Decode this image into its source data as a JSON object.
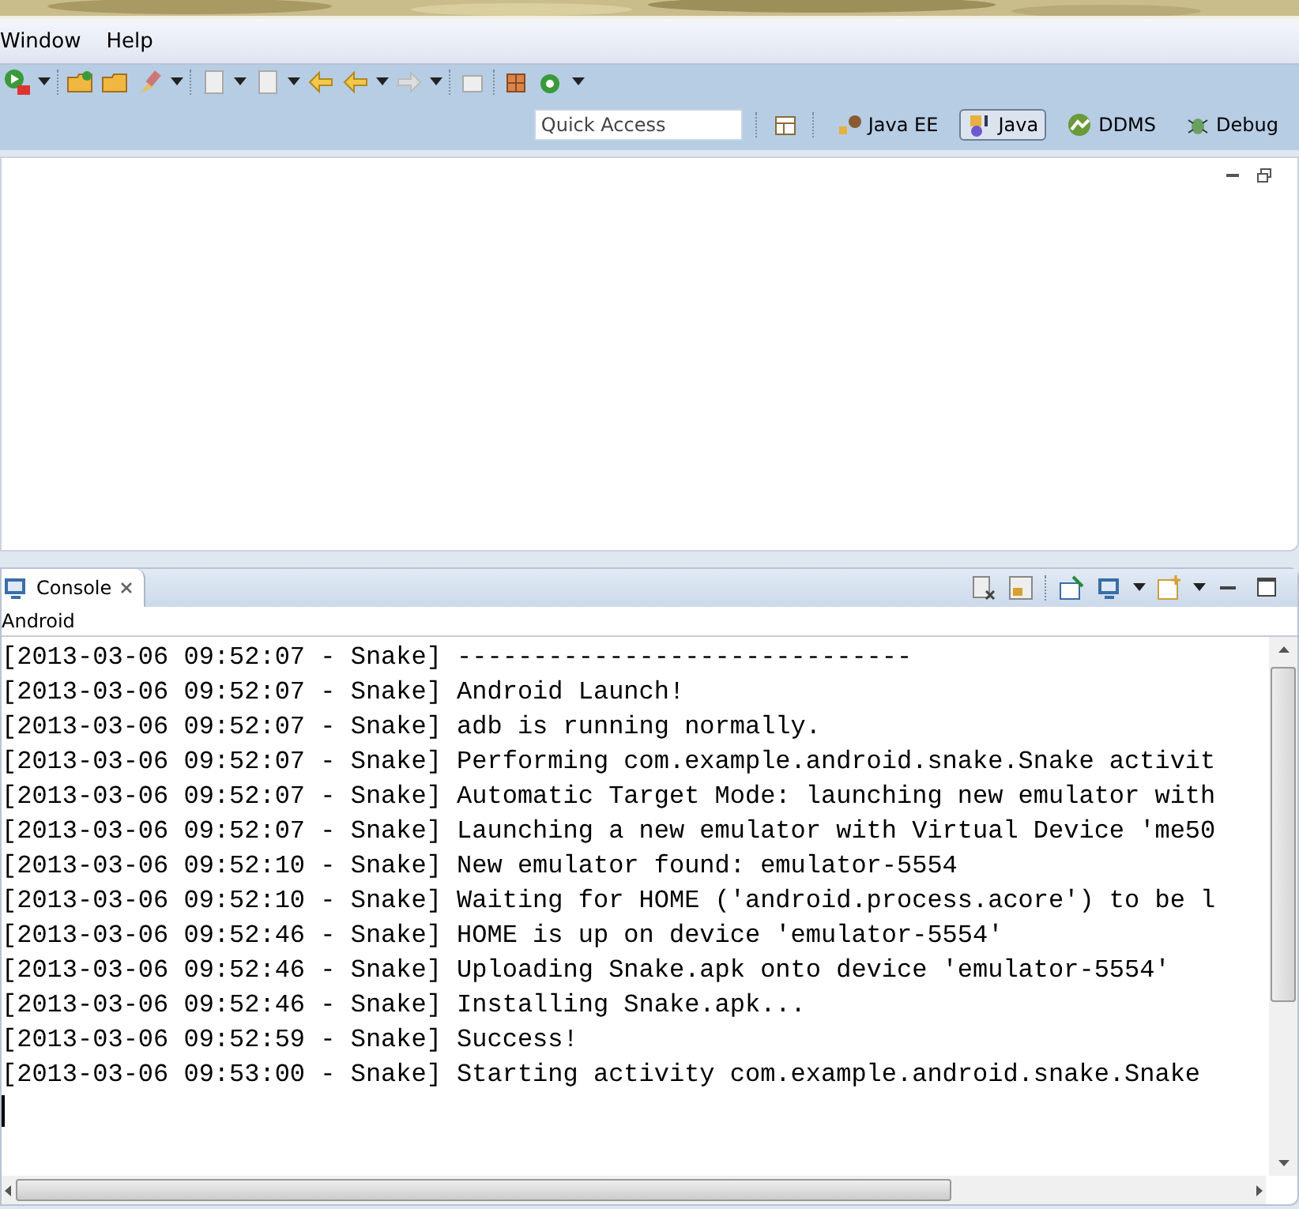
{
  "menu": [
    "Window",
    "Help"
  ],
  "quick_access": {
    "placeholder": "Quick Access"
  },
  "perspectives": [
    {
      "label": "Java EE",
      "selected": false
    },
    {
      "label": "Java",
      "selected": true
    },
    {
      "label": "DDMS",
      "selected": false
    },
    {
      "label": "Debug",
      "selected": false
    }
  ],
  "console": {
    "tab": "Console",
    "subtitle": "Android",
    "lines": [
      "[2013-03-06 09:52:07 - Snake] ------------------------------",
      "[2013-03-06 09:52:07 - Snake] Android Launch!",
      "[2013-03-06 09:52:07 - Snake] adb is running normally.",
      "[2013-03-06 09:52:07 - Snake] Performing com.example.android.snake.Snake activit",
      "[2013-03-06 09:52:07 - Snake] Automatic Target Mode: launching new emulator with",
      "[2013-03-06 09:52:07 - Snake] Launching a new emulator with Virtual Device 'me50",
      "[2013-03-06 09:52:10 - Snake] New emulator found: emulator-5554",
      "[2013-03-06 09:52:10 - Snake] Waiting for HOME ('android.process.acore') to be l",
      "[2013-03-06 09:52:46 - Snake] HOME is up on device 'emulator-5554'",
      "[2013-03-06 09:52:46 - Snake] Uploading Snake.apk onto device 'emulator-5554'",
      "[2013-03-06 09:52:46 - Snake] Installing Snake.apk...",
      "[2013-03-06 09:52:59 - Snake] Success!",
      "[2013-03-06 09:53:00 - Snake] Starting activity com.example.android.snake.Snake"
    ]
  }
}
